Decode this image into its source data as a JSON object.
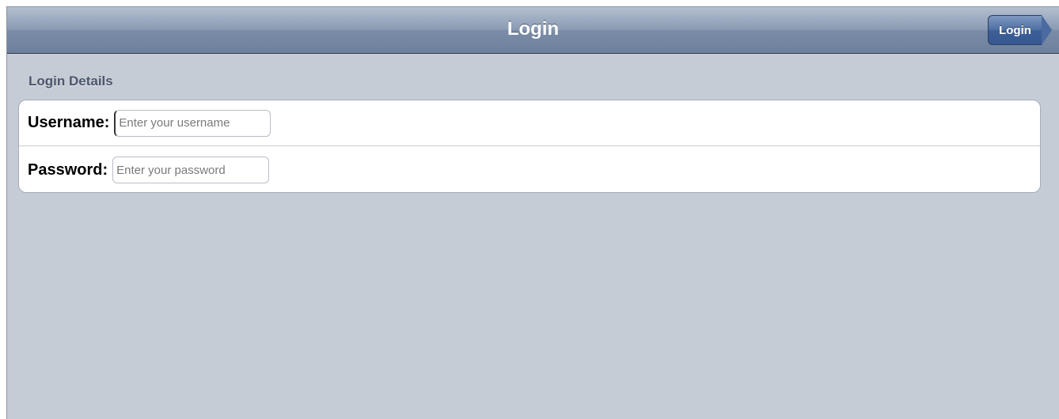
{
  "navbar": {
    "title": "Login",
    "button_label": "Login"
  },
  "section": {
    "header": "Login Details"
  },
  "form": {
    "username": {
      "label": "Username:",
      "placeholder": "Enter your username",
      "value": ""
    },
    "password": {
      "label": "Password:",
      "placeholder": "Enter your password",
      "value": ""
    }
  },
  "colors": {
    "background": "#c5ccd5",
    "navbar": "#7a8ca7",
    "button": "#4e6fa3",
    "section_header": "#4c566c"
  }
}
